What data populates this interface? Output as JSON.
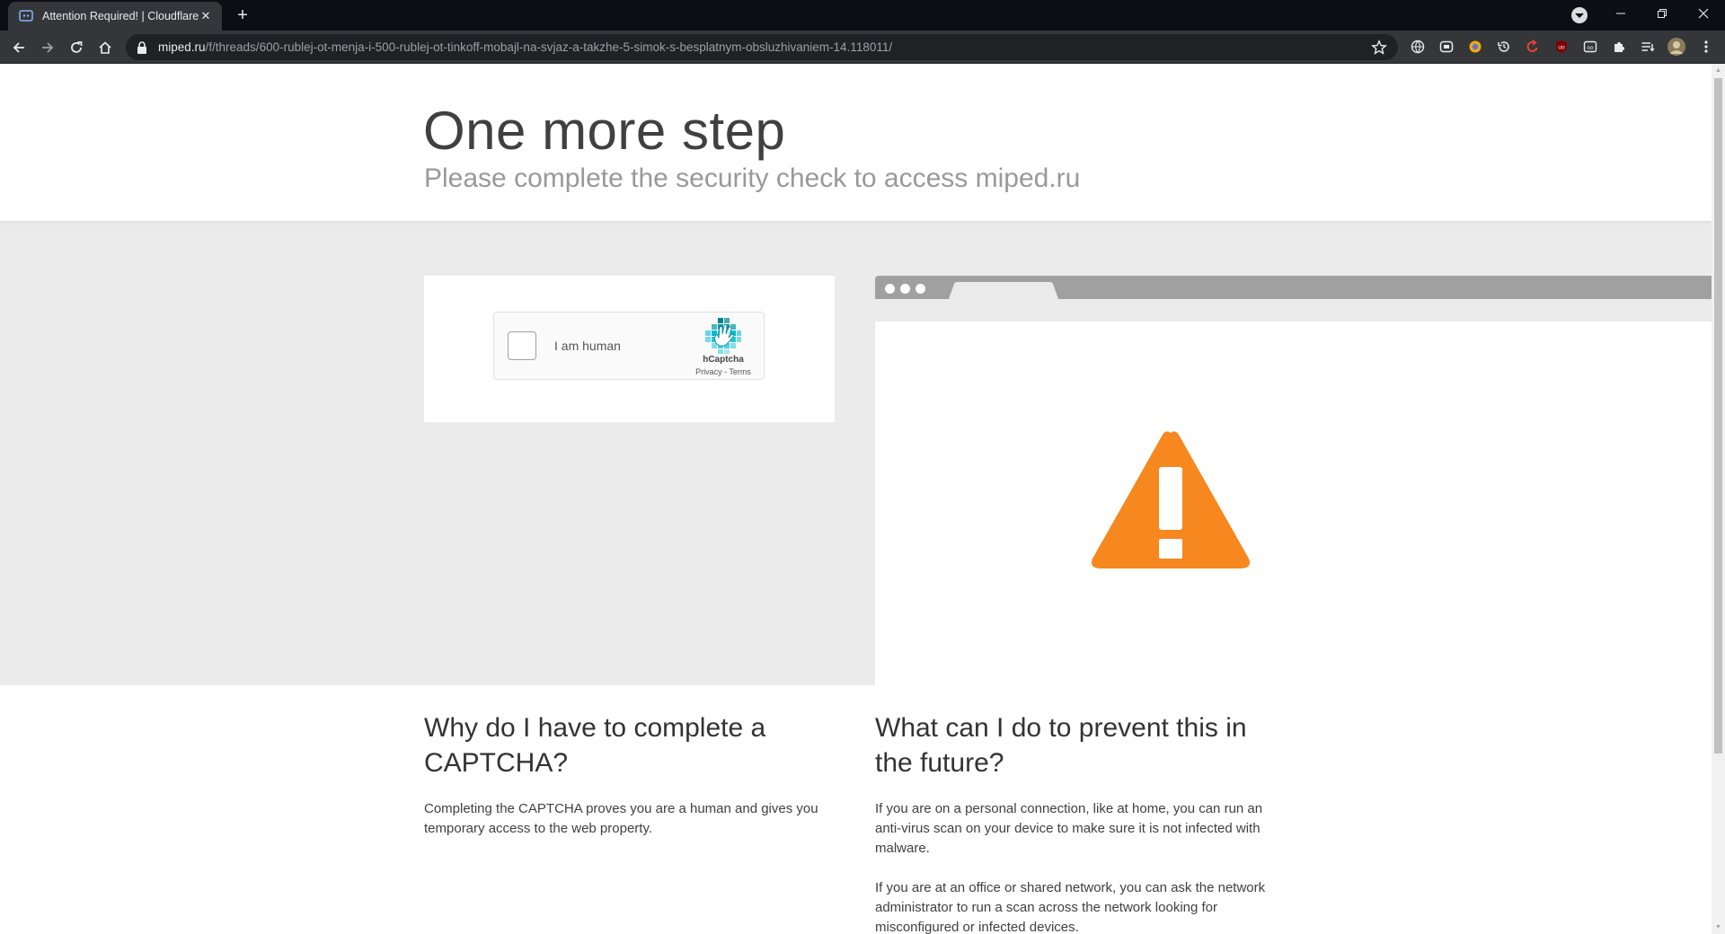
{
  "browser": {
    "tab_title": "Attention Required! | Cloudflare",
    "url_domain": "miped.ru",
    "url_path": "/f/threads/600-rublej-ot-menja-i-500-rublej-ot-tinkoff-mobajl-na-svjaz-a-takzhe-5-simok-s-besplatnym-obsluzhivaniem-14.118011/"
  },
  "header": {
    "title": "One more step",
    "subtitle": "Please complete the security check to access miped.ru"
  },
  "captcha": {
    "checkbox_label": "I am human",
    "brand": "hCaptcha",
    "privacy": "Privacy",
    "separator": " - ",
    "terms": "Terms"
  },
  "faq": {
    "why_title": "Why do I have to complete a CAPTCHA?",
    "why_text": "Completing the CAPTCHA proves you are a human and gives you temporary access to the web property.",
    "what_title": "What can I do to prevent this in the future?",
    "what_text_1": "If you are on a personal connection, like at home, you can run an anti-virus scan on your device to make sure it is not infected with malware.",
    "what_text_2": "If you are at an office or shared network, you can ask the network administrator to run a scan across the network looking for misconfigured or infected devices."
  },
  "colors": {
    "warning": "#f6881f",
    "chrome_dark": "#0c0e15",
    "toolbar": "#35363a",
    "band": "#ebebeb"
  },
  "icons": {
    "back": "back-arrow-icon",
    "forward": "forward-arrow-icon",
    "reload": "reload-icon",
    "home": "home-icon",
    "lock": "lock-icon",
    "bookmark": "star-icon",
    "warning": "warning-triangle-icon"
  }
}
